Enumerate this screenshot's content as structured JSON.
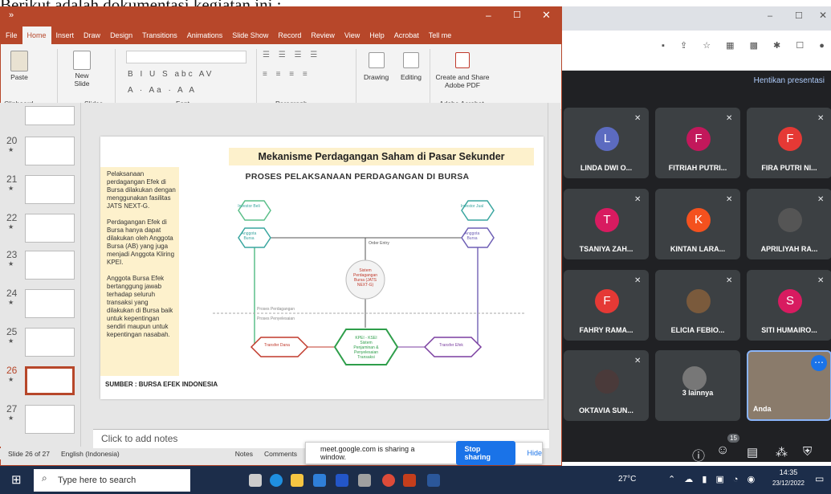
{
  "heading_text": "Berikut adalah dokumentasi kegiatan ini :",
  "ppt": {
    "tabs": [
      "File",
      "Home",
      "Insert",
      "Draw",
      "Design",
      "Transitions",
      "Animations",
      "Slide Show",
      "Record",
      "Review",
      "View",
      "Help",
      "Acrobat",
      "Tell me"
    ],
    "active_tab": "Home",
    "groups": {
      "clipboard": "Clipboard",
      "slides": "Slides",
      "font": "Font",
      "paragraph": "Paragraph",
      "adobe": "Adobe Acrobat"
    },
    "buttons": {
      "paste": "Paste",
      "new_slide": "New Slide",
      "drawing": "Drawing",
      "editing": "Editing",
      "create_share": "Create and Share Adobe PDF"
    },
    "thumb_numbers": [
      "20",
      "21",
      "22",
      "23",
      "24",
      "25",
      "26",
      "27"
    ],
    "slide": {
      "title": "Mekanisme Perdagangan Saham di Pasar Sekunder",
      "side_text": "Pelaksanaan perdagangan Efek di Bursa dilakukan dengan menggunakan fasilitas JATS NEXT-G.\n\nPerdagangan Efek di Bursa hanya dapat dilakukan oleh Anggota Bursa (AB) yang juga menjadi Anggota Kliring KPEI.\n\nAnggota Bursa Efek bertanggung jawab terhadap seluruh transaksi yang dilakukan di Bursa baik untuk kepentingan sendiri maupun untuk kepentingan nasabah.",
      "diagram_title": "PROSES PELAKSANAAN PERDAGANGAN DI BURSA",
      "source": "SUMBER : BURSA EFEK INDONESIA",
      "nodes": {
        "investor_beli": "Investor Beli",
        "anggota_bursa_l": "Anggota Bursa",
        "investor_jual": "Investor Jual",
        "anggota_bursa_r": "Anggota Bursa",
        "order_entry": "Order Entry",
        "sistem": "Sistem Perdagangan Bursa (JATS NEXT-G)",
        "proses_perdagangan": "Proses Perdagangan",
        "proses_penyelesaian": "Proses Penyelesaian",
        "transfer_dana": "Transfer Dana",
        "kpei": "KPEI - KSEI Sistem Penjaminan & Penyelesaian Transaksi",
        "transfer_efek": "Transfer Efek"
      }
    },
    "notes_placeholder": "Click to add notes",
    "status": {
      "slide": "Slide 26 of 27",
      "language": "English (Indonesia)",
      "notes": "Notes",
      "comments": "Comments"
    }
  },
  "meet": {
    "stop_presenting": "Hentikan presentasi",
    "participants": [
      {
        "initial": "L",
        "name": "LINDA DWI O...",
        "color": "#5c6bc0"
      },
      {
        "initial": "F",
        "name": "FITRIAH PUTRI...",
        "color": "#c2185b"
      },
      {
        "initial": "F",
        "name": "FIRA PUTRI NI...",
        "color": "#e53935"
      },
      {
        "initial": "T",
        "name": "TSANIYA ZAH...",
        "color": "#d81b60"
      },
      {
        "initial": "K",
        "name": "KINTAN LARA...",
        "color": "#f4511e"
      },
      {
        "initial": "",
        "name": "APRILIYAH RA...",
        "color": "#555"
      },
      {
        "initial": "F",
        "name": "FAHRY RAMA...",
        "color": "#e53935"
      },
      {
        "initial": "",
        "name": "ELICIA FEBIO...",
        "color": "#7a5a3c"
      },
      {
        "initial": "S",
        "name": "SITI HUMAIRO...",
        "color": "#d81b60"
      },
      {
        "initial": "",
        "name": "OKTAVIA SUN...",
        "color": "#4a3a3a"
      },
      {
        "initial": "",
        "name": "3 lainnya",
        "color": "#777"
      },
      {
        "initial": "",
        "name": "Anda",
        "color": "#8a7b6b"
      }
    ],
    "participant_count": "15"
  },
  "share_popup": {
    "message": "meet.google.com is sharing a window.",
    "stop": "Stop sharing",
    "hide": "Hide"
  },
  "taskbar": {
    "search": "Type here to search",
    "weather": "27°C",
    "time": "14:35",
    "date": "23/12/2022"
  }
}
